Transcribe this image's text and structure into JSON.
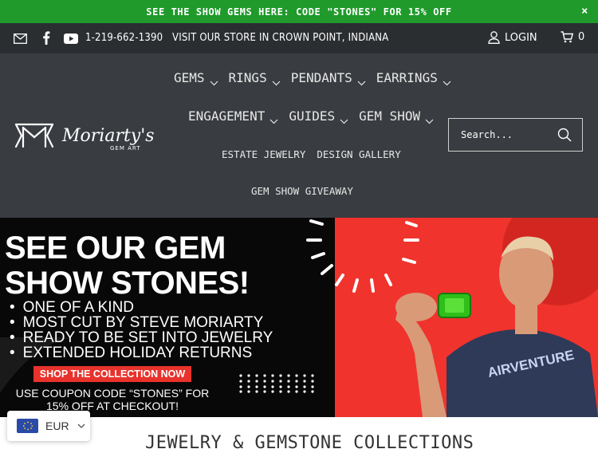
{
  "announcement": {
    "text": "SEE THE SHOW GEMS HERE: CODE \"STONES\" FOR 15% OFF",
    "close_label": "×"
  },
  "topbar": {
    "phone": "1-219-662-1390",
    "store": "VISIT OUR STORE IN CROWN POINT, INDIANA",
    "login_label": "LOGIN",
    "cart_count": "0",
    "icons": [
      "mail-icon",
      "facebook-icon",
      "youtube-icon",
      "user-icon",
      "cart-icon"
    ]
  },
  "logo": {
    "name": "Moriarty's",
    "subtitle": "GEM ART"
  },
  "nav": {
    "row1": [
      {
        "label": "GEMS",
        "has_dropdown": true
      },
      {
        "label": "RINGS",
        "has_dropdown": true
      },
      {
        "label": "PENDANTS",
        "has_dropdown": true
      },
      {
        "label": "EARRINGS",
        "has_dropdown": true
      }
    ],
    "row2": [
      {
        "label": "ENGAGEMENT",
        "has_dropdown": true
      },
      {
        "label": "GUIDES",
        "has_dropdown": true
      },
      {
        "label": "GEM SHOW",
        "has_dropdown": true
      }
    ],
    "row3": [
      {
        "label": "ESTATE JEWELRY"
      },
      {
        "label": "DESIGN GALLERY"
      }
    ],
    "row4": [
      {
        "label": "GEM SHOW GIVEAWAY"
      }
    ]
  },
  "search": {
    "placeholder": "Search..."
  },
  "hero": {
    "headline_line1": "SEE OUR GEM",
    "headline_line2": "SHOW STONES!",
    "bullets": [
      "ONE OF A KIND",
      "MOST CUT BY STEVE MORIARTY",
      "READY TO BE SET INTO JEWELRY",
      "EXTENDED HOLIDAY RETURNS"
    ],
    "cta_label": "SHOP THE COLLECTION NOW",
    "coupon_line1": "USE COUPON CODE “STONES” FOR",
    "coupon_line2": "15% OFF AT CHECKOUT!",
    "shirt_text": "AIRVENTURE",
    "colors": {
      "accent_red": "#f0332c",
      "gem_green": "#2fbf1a"
    }
  },
  "currency": {
    "code": "EUR"
  },
  "section": {
    "title": "JEWELRY & GEMSTONE COLLECTIONS"
  }
}
